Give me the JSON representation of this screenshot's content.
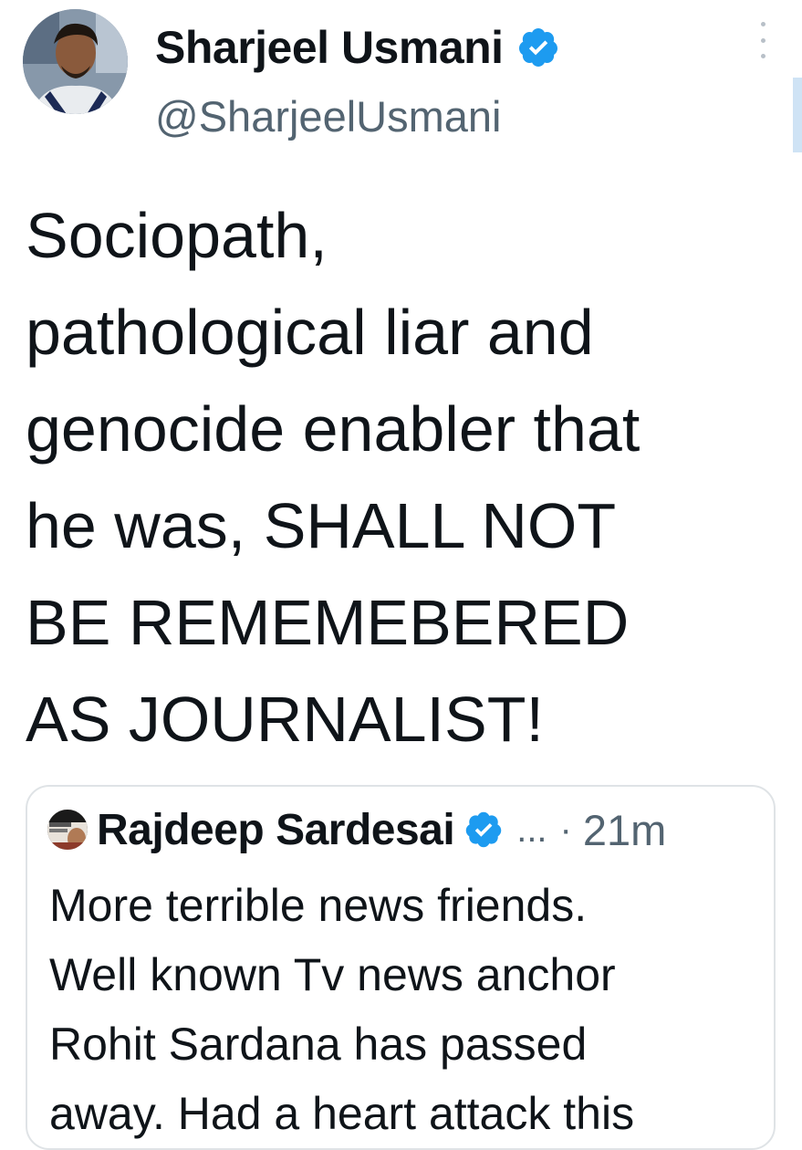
{
  "author": {
    "display_name": "Sharjeel Usmani",
    "handle": "@SharjeelUsmani",
    "verified_icon": "verified-badge-icon",
    "avatar_icon": "profile-photo"
  },
  "tweet": {
    "text": "Sociopath,\npathological liar and\ngenocide enabler that\nhe was, SHALL NOT\nBE REMEMEBERED\nAS JOURNALIST!"
  },
  "quoted_tweet": {
    "display_name": "Rajdeep Sardesai",
    "ellipsis": "...",
    "separator": "·",
    "time": "21m",
    "text": "More terrible news friends.\nWell known Tv news anchor\nRohit Sardana has passed\naway. Had a heart attack this"
  },
  "colors": {
    "verified_blue": "#1d9bf0",
    "secondary_text": "#536471",
    "border": "#dfe3e6",
    "primary_text": "#0f1419"
  }
}
